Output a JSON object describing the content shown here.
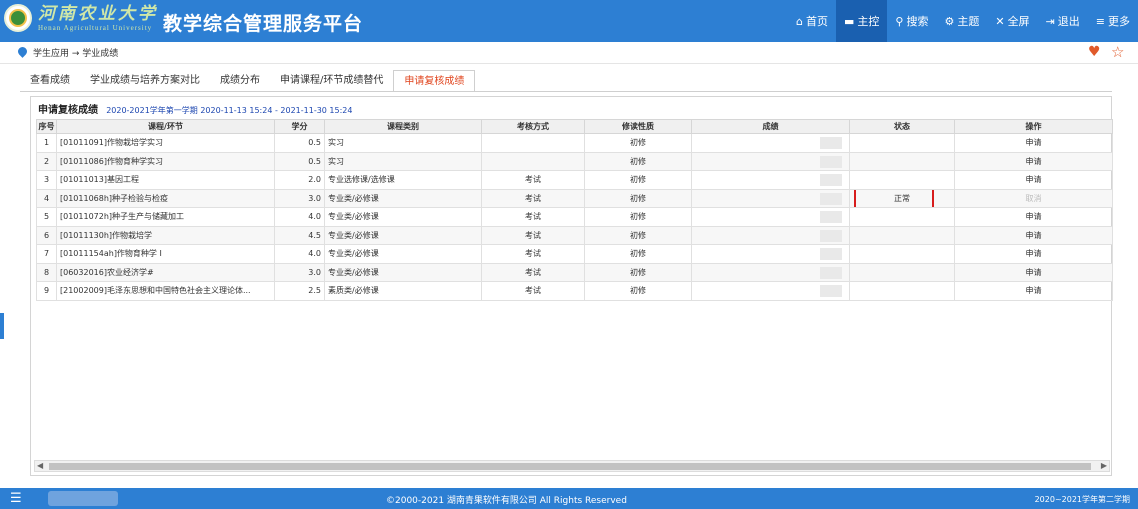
{
  "header": {
    "university_cn": "河南农业大学",
    "university_en": "Henan Agricultural University",
    "app_title": "教学综合管理服务平台",
    "nav": [
      {
        "icon": "home-icon",
        "glyph": "⌂",
        "label": "首页"
      },
      {
        "icon": "dashboard-icon",
        "glyph": "▬",
        "label": "主控"
      },
      {
        "icon": "search-icon",
        "glyph": "⚲",
        "label": "搜索"
      },
      {
        "icon": "theme-icon",
        "glyph": "⚙",
        "label": "主题"
      },
      {
        "icon": "fullscreen-icon",
        "glyph": "✕",
        "label": "全屏"
      },
      {
        "icon": "logout-icon",
        "glyph": "⇥",
        "label": "退出"
      },
      {
        "icon": "more-icon",
        "glyph": "≡",
        "label": "更多"
      }
    ]
  },
  "breadcrumb": "学生应用 → 学业成绩",
  "tabs": [
    "查看成绩",
    "学业成绩与培养方案对比",
    "成绩分布",
    "申请课程/环节成绩替代",
    "申请复核成绩"
  ],
  "panel": {
    "label": "申请复核成绩",
    "period": "2020-2021学年第一学期 2020-11-13 15:24 - 2021-11-30 15:24"
  },
  "table": {
    "headers": [
      "序号",
      "课程/环节",
      "学分",
      "课程类别",
      "考核方式",
      "修读性质",
      "成绩",
      "状态",
      "操作"
    ],
    "rows": [
      {
        "no": "1",
        "course": "[01011091]作物栽培学实习",
        "credit": "0.5",
        "category": "实习",
        "exam": "",
        "nature": "初修",
        "status": "",
        "action": "申请"
      },
      {
        "no": "2",
        "course": "[01011086]作物育种学实习",
        "credit": "0.5",
        "category": "实习",
        "exam": "",
        "nature": "初修",
        "status": "",
        "action": "申请"
      },
      {
        "no": "3",
        "course": "[01011013]基因工程",
        "credit": "2.0",
        "category": "专业选修课/选修课",
        "exam": "考试",
        "nature": "初修",
        "status": "",
        "action": "申请"
      },
      {
        "no": "4",
        "course": "[01011068h]种子检验与检疫",
        "credit": "3.0",
        "category": "专业类/必修课",
        "exam": "考试",
        "nature": "初修",
        "status": "正常",
        "action": "取消"
      },
      {
        "no": "5",
        "course": "[01011072h]种子生产与储藏加工",
        "credit": "4.0",
        "category": "专业类/必修课",
        "exam": "考试",
        "nature": "初修",
        "status": "",
        "action": "申请"
      },
      {
        "no": "6",
        "course": "[01011130h]作物栽培学",
        "credit": "4.5",
        "category": "专业类/必修课",
        "exam": "考试",
        "nature": "初修",
        "status": "",
        "action": "申请"
      },
      {
        "no": "7",
        "course": "[01011154ah]作物育种学 I",
        "credit": "4.0",
        "category": "专业类/必修课",
        "exam": "考试",
        "nature": "初修",
        "status": "",
        "action": "申请"
      },
      {
        "no": "8",
        "course": "[06032016]农业经济学#",
        "credit": "3.0",
        "category": "专业类/必修课",
        "exam": "考试",
        "nature": "初修",
        "status": "",
        "action": "申请"
      },
      {
        "no": "9",
        "course": "[21002009]毛泽东思想和中国特色社会主义理论体...",
        "credit": "2.5",
        "category": "素质类/必修课",
        "exam": "考试",
        "nature": "初修",
        "status": "",
        "action": "申请"
      }
    ]
  },
  "footer": {
    "copyright": "©2000-2021 湖南青果软件有限公司 All Rights Reserved",
    "semester": "2020~2021学年第二学期"
  }
}
